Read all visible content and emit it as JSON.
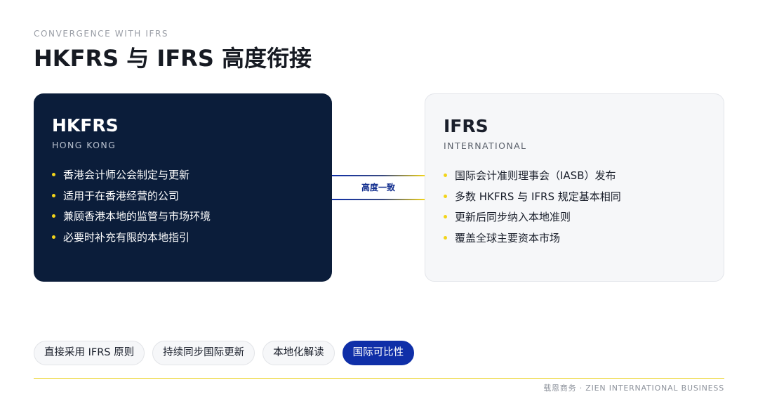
{
  "header": {
    "eyebrow": "CONVERGENCE WITH IFRS",
    "title": "HKFRS 与 IFRS 高度衔接"
  },
  "cards": {
    "hkfrs": {
      "name": "HKFRS",
      "subtitle": "HONG KONG",
      "points": [
        "香港会计师公会制定与更新",
        "适用于在香港经营的公司",
        "兼顾香港本地的监管与市场环境",
        "必要时补充有限的本地指引"
      ]
    },
    "ifrs": {
      "name": "IFRS",
      "subtitle": "INTERNATIONAL",
      "points": [
        "国际会计准则理事会（IASB）发布",
        "多数 HKFRS 与 IFRS 规定基本相同",
        "更新后同步纳入本地准则",
        "覆盖全球主要资本市场"
      ]
    }
  },
  "connector": {
    "label": "高度一致"
  },
  "tags": [
    {
      "label": "直接采用 IFRS 原则",
      "active": false
    },
    {
      "label": "持续同步国际更新",
      "active": false
    },
    {
      "label": "本地化解读",
      "active": false
    },
    {
      "label": "国际可比性",
      "active": true
    }
  ],
  "footer": {
    "text": "载恩商务 · ZIEN INTERNATIONAL BUSINESS"
  },
  "colors": {
    "navy": "#0b1d3a",
    "accent_blue": "#0f2fa8",
    "accent_yellow": "#f2d41a"
  }
}
